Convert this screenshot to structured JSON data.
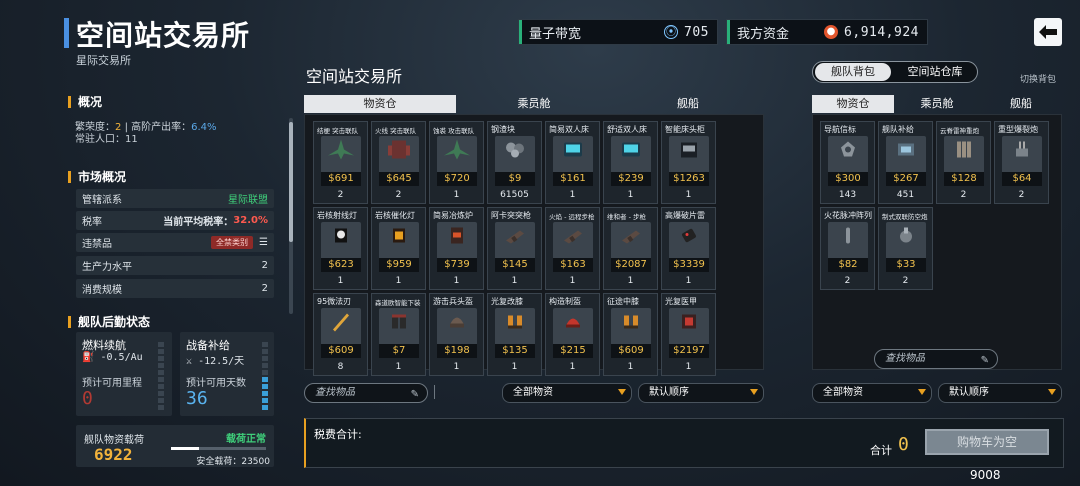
{
  "header": {
    "title": "空间站交易所",
    "subtitle": "星际交易所",
    "bandwidth_label": "量子带宽",
    "bandwidth_value": "705",
    "funds_label": "我方资金",
    "funds_value": "6,914,924"
  },
  "overview": {
    "heading": "概况",
    "prosperity_label": "繁荣度：",
    "prosperity_value": "2",
    "output_label": "| 高阶产出率：",
    "output_value": "6.4%",
    "population_label": "常驻人口：",
    "population_value": "11"
  },
  "market": {
    "heading": "市场概况",
    "rows": [
      {
        "label": "管辖派系",
        "value": "星际联盟"
      },
      {
        "label": "税率",
        "value_prefix": "当前平均税率：",
        "value": "32.0%"
      },
      {
        "label": "违禁品",
        "value": "全禁类别",
        "icon": "menu-icon"
      },
      {
        "label": "生产力水平",
        "value": "2"
      },
      {
        "label": "消费规模",
        "value": "2"
      }
    ]
  },
  "fleet": {
    "heading": "舰队后勤状态",
    "fuel": {
      "title": "燃料续航",
      "rate": "-0.5/Au",
      "sub": "预计可用里程",
      "value": "0"
    },
    "supply": {
      "title": "战备补给",
      "rate": "-12.5/天",
      "sub": "预计可用天数",
      "value": "36"
    },
    "fuel_level": 0,
    "supply_level": 0.5,
    "cargo": {
      "title": "舰队物资载荷",
      "status": "载荷正常",
      "value": "6922",
      "safe_label": "安全载荷：",
      "safe_value": "23500",
      "fill": 0.294
    }
  },
  "exchange": {
    "title": "空间站交易所",
    "tabs": [
      "物资仓",
      "乘员舱",
      "舰船"
    ],
    "items": [
      {
        "name": "结梗 突击联队",
        "price": "$691",
        "qty": "2",
        "art": "ship-green-icon",
        "small": true
      },
      {
        "name": "火线 突击联队",
        "price": "$645",
        "qty": "2",
        "art": "ship-red-icon",
        "small": true
      },
      {
        "name": "蚀裘 攻击联队",
        "price": "$720",
        "qty": "1",
        "art": "ship-green-icon",
        "small": true
      },
      {
        "name": "钢渣块",
        "price": "$9",
        "qty": "61505",
        "art": "ore-icon"
      },
      {
        "name": "简易双人床",
        "price": "$161",
        "qty": "1",
        "art": "bed-icon"
      },
      {
        "name": "舒适双人床",
        "price": "$239",
        "qty": "1",
        "art": "bed-icon"
      },
      {
        "name": "智能床头柜",
        "price": "$1263",
        "qty": "1",
        "art": "cabinet-icon"
      },
      {
        "name": "岩核射线灯",
        "price": "$623",
        "qty": "1",
        "art": "lamp-icon"
      },
      {
        "name": "岩核催化灯",
        "price": "$959",
        "qty": "1",
        "art": "lamp-orange-icon"
      },
      {
        "name": "简易冶炼炉",
        "price": "$739",
        "qty": "1",
        "art": "furnace-icon"
      },
      {
        "name": "阿卡突突枪",
        "price": "$145",
        "qty": "1",
        "art": "gun-icon"
      },
      {
        "name": "火焰 - 远程步枪",
        "price": "$163",
        "qty": "1",
        "art": "gun-icon",
        "small": true
      },
      {
        "name": "维和者 - 步枪",
        "price": "$2087",
        "qty": "1",
        "art": "gun-icon",
        "small": true
      },
      {
        "name": "高爆破片雷",
        "price": "$3339",
        "qty": "1",
        "art": "mine-icon"
      },
      {
        "name": "95微法刃",
        "price": "$609",
        "qty": "8",
        "art": "blade-icon"
      },
      {
        "name": "森道欧智能下装",
        "price": "$7",
        "qty": "1",
        "art": "pants-icon",
        "small": true
      },
      {
        "name": "游击兵头盔",
        "price": "$198",
        "qty": "1",
        "art": "helmet-icon"
      },
      {
        "name": "光复改膝",
        "price": "$135",
        "qty": "1",
        "art": "boots-icon"
      },
      {
        "name": "构造制盔",
        "price": "$215",
        "qty": "1",
        "art": "helmet-red-icon"
      },
      {
        "name": "征途中膝",
        "price": "$609",
        "qty": "1",
        "art": "boots-icon"
      },
      {
        "name": "光复医甲",
        "price": "$2197",
        "qty": "1",
        "art": "armor-icon"
      }
    ],
    "search_placeholder": "查找物品",
    "filter_label": "全部物资",
    "sort_label": "默认顺序"
  },
  "inventory": {
    "toggle_active": "舰队背包",
    "toggle_inactive": "空间站仓库",
    "switch_label": "切换背包",
    "tabs": [
      "物资仓",
      "乘员舱",
      "舰船"
    ],
    "items": [
      {
        "name": "导航信标",
        "price": "$300",
        "qty": "143",
        "art": "beacon-icon"
      },
      {
        "name": "舰队补给",
        "price": "$267",
        "qty": "451",
        "art": "supply-icon"
      },
      {
        "name": "云脊雷神重炮",
        "price": "$128",
        "qty": "2",
        "art": "cannon-icon",
        "small": true
      },
      {
        "name": "重型爆裂炮",
        "price": "$64",
        "qty": "2",
        "art": "turret-icon"
      },
      {
        "name": "火花脉冲阵列",
        "price": "$82",
        "qty": "2",
        "art": "pulse-icon"
      },
      {
        "name": "制式双联防空炮",
        "price": "$33",
        "qty": "2",
        "art": "aa-gun-icon",
        "small": true
      }
    ],
    "search_placeholder": "查找物品",
    "filter_label": "全部物资",
    "sort_label": "默认顺序"
  },
  "tax": {
    "label": "税费合计:",
    "total_label": "合计",
    "total_value": "0",
    "cart_button": "购物车为空"
  },
  "footer_value": "9008",
  "colors": {
    "accent": "#e8a020",
    "price": "#f2c24e",
    "positive": "#3fcf7a",
    "danger": "#ff5a4f",
    "info": "#3a9fd8"
  }
}
